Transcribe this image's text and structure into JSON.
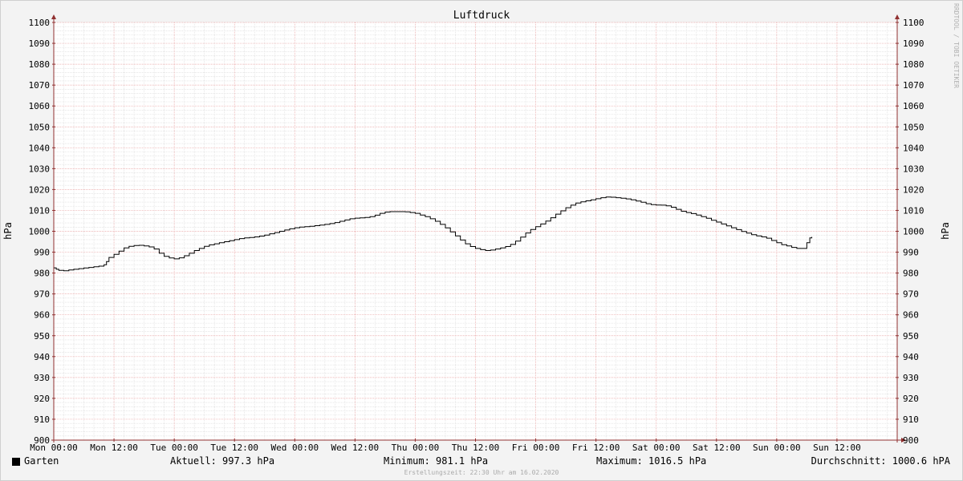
{
  "chart_data": {
    "type": "line",
    "title": "Luftdruck",
    "ylabel": "hPa",
    "ylabel_right": "hPa",
    "xlabel": "",
    "ylim": [
      900,
      1100
    ],
    "xlim": [
      0,
      168
    ],
    "y_ticks": [
      "900",
      "910",
      "920",
      "930",
      "940",
      "950",
      "960",
      "970",
      "980",
      "990",
      "1000",
      "1010",
      "1020",
      "1030",
      "1040",
      "1050",
      "1060",
      "1070",
      "1080",
      "1090",
      "1100"
    ],
    "x_tick_hours": [
      0,
      12,
      24,
      36,
      48,
      60,
      72,
      84,
      96,
      108,
      120,
      132,
      144,
      156
    ],
    "x_tick_labels": [
      "Mon 00:00",
      "Mon 12:00",
      "Tue 00:00",
      "Tue 12:00",
      "Wed 00:00",
      "Wed 12:00",
      "Thu 00:00",
      "Thu 12:00",
      "Fri 00:00",
      "Fri 12:00",
      "Sat 00:00",
      "Sat 12:00",
      "Sun 00:00",
      "Sun 12:00"
    ],
    "grid": true,
    "legend_position": "bottom-left",
    "series": [
      {
        "name": "Garten",
        "color": "#000000",
        "points": [
          [
            0,
            982.5
          ],
          [
            0.5,
            981.8
          ],
          [
            1,
            981.3
          ],
          [
            2,
            981.1
          ],
          [
            3,
            981.5
          ],
          [
            4,
            981.8
          ],
          [
            5,
            982.1
          ],
          [
            6,
            982.4
          ],
          [
            7,
            982.7
          ],
          [
            8,
            983.0
          ],
          [
            9,
            983.3
          ],
          [
            10,
            984.0
          ],
          [
            10.5,
            985.5
          ],
          [
            11,
            987.5
          ],
          [
            12,
            989.0
          ],
          [
            13,
            990.5
          ],
          [
            14,
            992.0
          ],
          [
            15,
            992.8
          ],
          [
            16,
            993.2
          ],
          [
            17,
            993.3
          ],
          [
            18,
            993.0
          ],
          [
            19,
            992.5
          ],
          [
            20,
            991.5
          ],
          [
            21,
            989.5
          ],
          [
            22,
            988.0
          ],
          [
            23,
            987.2
          ],
          [
            24,
            986.8
          ],
          [
            25,
            987.3
          ],
          [
            26,
            988.3
          ],
          [
            27,
            989.5
          ],
          [
            28,
            990.8
          ],
          [
            29,
            991.8
          ],
          [
            30,
            992.8
          ],
          [
            31,
            993.5
          ],
          [
            32,
            994.0
          ],
          [
            33,
            994.5
          ],
          [
            34,
            995.0
          ],
          [
            35,
            995.5
          ],
          [
            36,
            996.0
          ],
          [
            37,
            996.5
          ],
          [
            38,
            996.8
          ],
          [
            39,
            997.0
          ],
          [
            40,
            997.3
          ],
          [
            41,
            997.7
          ],
          [
            42,
            998.2
          ],
          [
            43,
            998.8
          ],
          [
            44,
            999.4
          ],
          [
            45,
            1000.0
          ],
          [
            46,
            1000.6
          ],
          [
            47,
            1001.2
          ],
          [
            48,
            1001.7
          ],
          [
            49,
            1002.0
          ],
          [
            50,
            1002.2
          ],
          [
            51,
            1002.4
          ],
          [
            52,
            1002.7
          ],
          [
            53,
            1003.0
          ],
          [
            54,
            1003.3
          ],
          [
            55,
            1003.7
          ],
          [
            56,
            1004.2
          ],
          [
            57,
            1004.8
          ],
          [
            58,
            1005.4
          ],
          [
            59,
            1006.0
          ],
          [
            60,
            1006.3
          ],
          [
            61,
            1006.4
          ],
          [
            62,
            1006.6
          ],
          [
            63,
            1007.0
          ],
          [
            64,
            1007.7
          ],
          [
            65,
            1008.6
          ],
          [
            66,
            1009.2
          ],
          [
            67,
            1009.4
          ],
          [
            68,
            1009.4
          ],
          [
            69,
            1009.4
          ],
          [
            70,
            1009.3
          ],
          [
            71,
            1009.0
          ],
          [
            72,
            1008.6
          ],
          [
            73,
            1007.8
          ],
          [
            74,
            1007.0
          ],
          [
            75,
            1006.0
          ],
          [
            76,
            1004.8
          ],
          [
            77,
            1003.3
          ],
          [
            78,
            1001.6
          ],
          [
            79,
            999.7
          ],
          [
            80,
            997.8
          ],
          [
            81,
            995.8
          ],
          [
            82,
            994.0
          ],
          [
            83,
            992.7
          ],
          [
            84,
            991.8
          ],
          [
            85,
            991.2
          ],
          [
            86,
            990.8
          ],
          [
            87,
            991.0
          ],
          [
            88,
            991.5
          ],
          [
            89,
            992.0
          ],
          [
            90,
            992.7
          ],
          [
            91,
            993.7
          ],
          [
            92,
            995.3
          ],
          [
            93,
            997.2
          ],
          [
            94,
            999.2
          ],
          [
            95,
            1000.9
          ],
          [
            96,
            1002.2
          ],
          [
            97,
            1003.5
          ],
          [
            98,
            1004.9
          ],
          [
            99,
            1006.5
          ],
          [
            100,
            1008.2
          ],
          [
            101,
            1009.8
          ],
          [
            102,
            1011.3
          ],
          [
            103,
            1012.5
          ],
          [
            104,
            1013.5
          ],
          [
            105,
            1014.1
          ],
          [
            106,
            1014.6
          ],
          [
            107,
            1015.1
          ],
          [
            108,
            1015.6
          ],
          [
            109,
            1016.1
          ],
          [
            110,
            1016.4
          ],
          [
            111,
            1016.3
          ],
          [
            112,
            1016.1
          ],
          [
            113,
            1015.8
          ],
          [
            114,
            1015.5
          ],
          [
            115,
            1015.1
          ],
          [
            116,
            1014.5
          ],
          [
            117,
            1013.9
          ],
          [
            118,
            1013.2
          ],
          [
            119,
            1012.8
          ],
          [
            120,
            1012.6
          ],
          [
            121,
            1012.5
          ],
          [
            122,
            1012.2
          ],
          [
            123,
            1011.5
          ],
          [
            124,
            1010.5
          ],
          [
            125,
            1009.6
          ],
          [
            126,
            1009.0
          ],
          [
            127,
            1008.5
          ],
          [
            128,
            1007.8
          ],
          [
            129,
            1007.0
          ],
          [
            130,
            1006.2
          ],
          [
            131,
            1005.3
          ],
          [
            132,
            1004.4
          ],
          [
            133,
            1003.5
          ],
          [
            134,
            1002.6
          ],
          [
            135,
            1001.7
          ],
          [
            136,
            1000.8
          ],
          [
            137,
            999.9
          ],
          [
            138,
            999.1
          ],
          [
            139,
            998.4
          ],
          [
            140,
            997.8
          ],
          [
            141,
            997.3
          ],
          [
            142,
            996.7
          ],
          [
            143,
            995.6
          ],
          [
            144,
            994.5
          ],
          [
            145,
            993.6
          ],
          [
            146,
            993.0
          ],
          [
            147,
            992.3
          ],
          [
            148,
            991.8
          ],
          [
            149,
            991.8
          ],
          [
            150,
            994.5
          ],
          [
            150.6,
            996.8
          ],
          [
            151,
            997.3
          ]
        ]
      }
    ],
    "stats": {
      "aktuell": "Aktuell: 997.3 hPa",
      "minimum": "Minimum: 981.1 hPa",
      "maximum": "Maximum: 1016.5 hPa",
      "durchschnitt": "Durchschnitt: 1000.6 hPA"
    },
    "footer": "Erstellungszeit: 22:30 Uhr am 16.02.2020",
    "watermark": "RRDTOOL / TOBI OETIKER",
    "colors": {
      "background": "#f3f3f3",
      "canvas": "#ffffff",
      "grid_minor": "#d8d8d8",
      "grid_major": "#e8a0a0",
      "axis": "#903030",
      "line": "#000000"
    }
  }
}
